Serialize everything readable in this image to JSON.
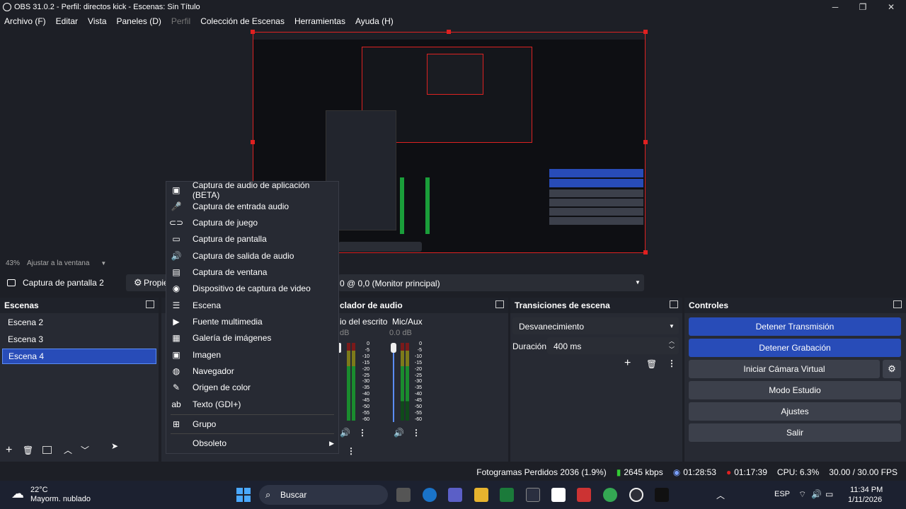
{
  "window": {
    "title": "OBS 31.0.2 - Perfil: directos kick - Escenas: Sin Título"
  },
  "menubar": [
    {
      "label": "Archivo (F)",
      "dim": false
    },
    {
      "label": "Editar",
      "dim": false
    },
    {
      "label": "Vista",
      "dim": false
    },
    {
      "label": "Paneles (D)",
      "dim": false
    },
    {
      "label": "Perfil",
      "dim": true
    },
    {
      "label": "Colección de Escenas",
      "dim": false
    },
    {
      "label": "Herramientas",
      "dim": false
    },
    {
      "label": "Ayuda (H)",
      "dim": false
    }
  ],
  "preview": {
    "zoom": "43%",
    "fit_label": "Ajustar a la ventana"
  },
  "source_toolbar": {
    "selected_source": "Captura de pantalla 2",
    "properties_label": "Propie",
    "monitor": "0 @ 0,0 (Monitor principal)"
  },
  "scenes": {
    "title": "Escenas",
    "items": [
      "Escena 2",
      "Escena 3",
      "Escena 4"
    ],
    "selected": "Escena 4"
  },
  "mixer": {
    "title": "clador de audio",
    "channels": [
      {
        "name": "io del escrito",
        "db": "dB"
      },
      {
        "name": "Mic/Aux",
        "db": "0.0 dB"
      }
    ],
    "scale": [
      "0",
      "-5",
      "-10",
      "-15",
      "-20",
      "-25",
      "-30",
      "-35",
      "-40",
      "-45",
      "-50",
      "-55",
      "-60"
    ]
  },
  "transitions": {
    "title": "Transiciones de escena",
    "selected": "Desvanecimiento",
    "duration_label": "Duración",
    "duration_value": "400 ms"
  },
  "controls": {
    "title": "Controles",
    "stop_stream": "Detener Transmisión",
    "stop_record": "Detener Grabación",
    "virtual_cam": "Iniciar Cámara Virtual",
    "studio_mode": "Modo Estudio",
    "settings": "Ajustes",
    "exit": "Salir"
  },
  "context_menu": {
    "items": [
      {
        "label": "Captura de audio de aplicación (BETA)",
        "icon": "app-audio-icon"
      },
      {
        "label": "Captura de entrada audio",
        "icon": "microphone-icon"
      },
      {
        "label": "Captura de juego",
        "icon": "gamepad-icon"
      },
      {
        "label": "Captura de pantalla",
        "icon": "monitor-icon"
      },
      {
        "label": "Captura de salida de audio",
        "icon": "speaker-icon"
      },
      {
        "label": "Captura de ventana",
        "icon": "window-icon"
      },
      {
        "label": "Dispositivo de captura de video",
        "icon": "camera-icon"
      },
      {
        "label": "Escena",
        "icon": "list-icon"
      },
      {
        "label": "Fuente multimedia",
        "icon": "play-icon"
      },
      {
        "label": "Galería de imágenes",
        "icon": "gallery-icon"
      },
      {
        "label": "Imagen",
        "icon": "image-icon"
      },
      {
        "label": "Navegador",
        "icon": "globe-icon"
      },
      {
        "label": "Origen de color",
        "icon": "brush-icon"
      },
      {
        "label": "Texto (GDI+)",
        "icon": "text-icon"
      }
    ],
    "group": "Grupo",
    "obsolete": "Obsoleto"
  },
  "status": {
    "dropped": "Fotogramas Perdidos 2036 (1.9%)",
    "bitrate": "2645 kbps",
    "stream_time": "01:28:53",
    "record_time": "01:17:39",
    "cpu": "CPU: 6.3%",
    "fps": "30.00 / 30.00 FPS"
  },
  "taskbar": {
    "weather_temp": "22°C",
    "weather_desc": "Mayorm. nublado",
    "search": "Buscar",
    "lang": "ESP",
    "time": "11:34 PM",
    "date": "1/11/2026"
  },
  "colors": {
    "accent": "#284cb8",
    "record": "#e02020",
    "bg": "#1d1f26",
    "dock": "#272a33"
  }
}
